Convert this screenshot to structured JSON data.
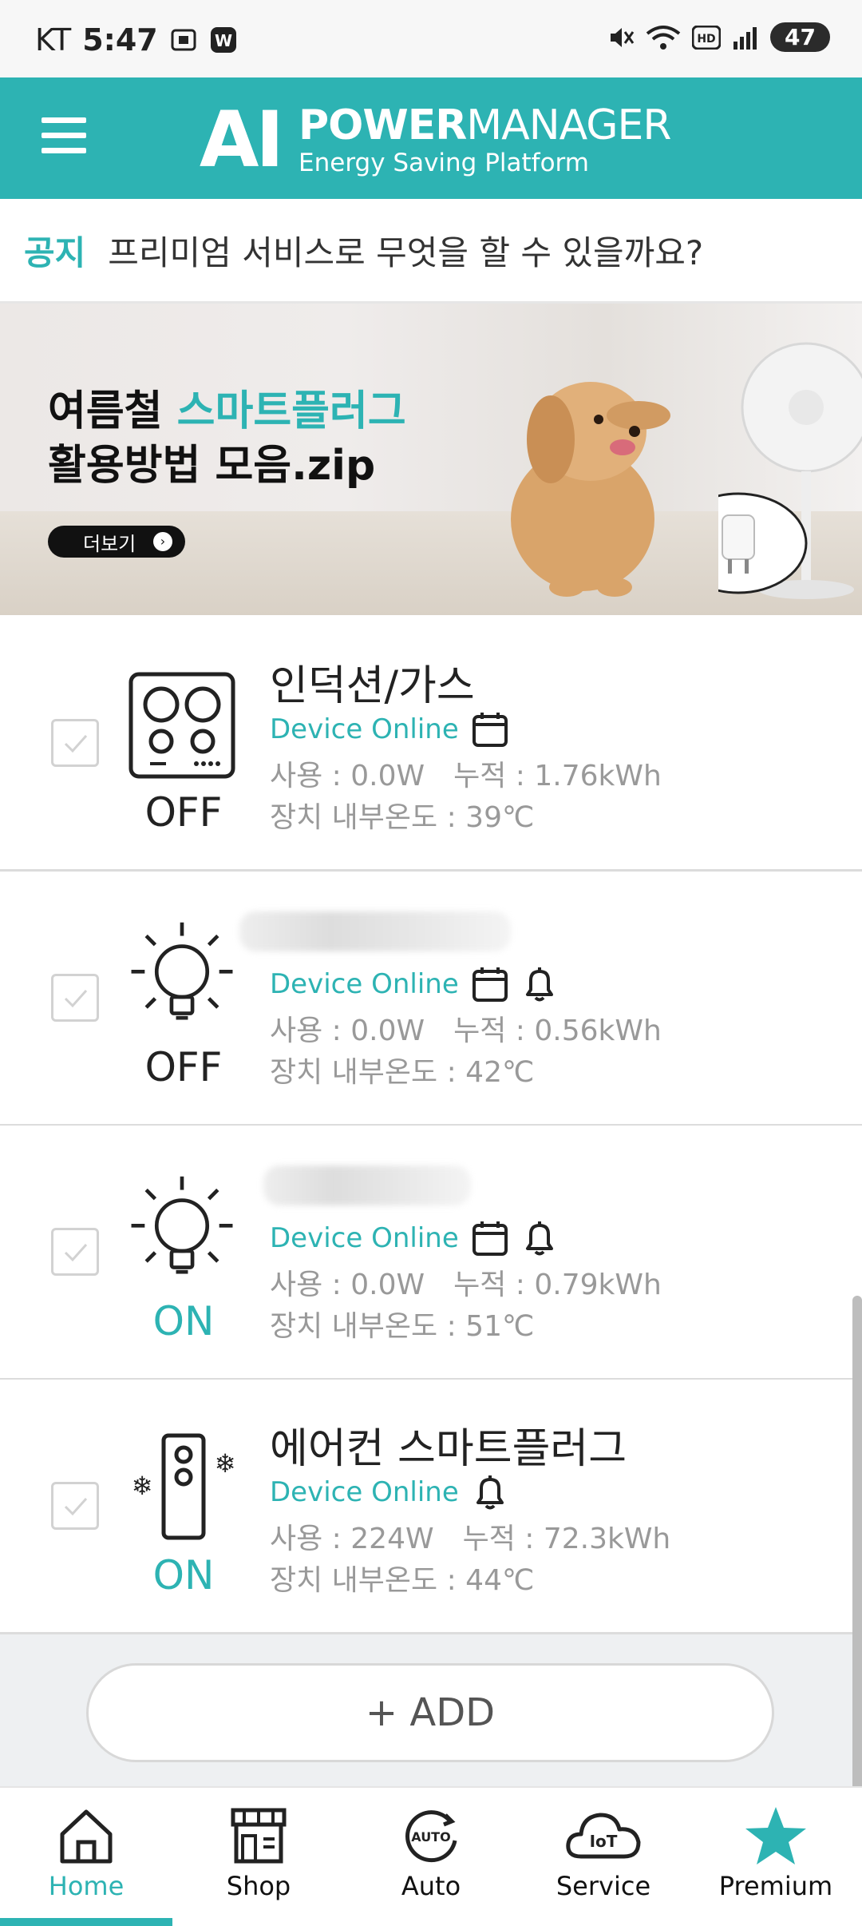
{
  "status_bar": {
    "carrier": "KT",
    "time": "5:47",
    "battery": "47"
  },
  "header": {
    "logo_ai": "AI",
    "logo_power": "POWER",
    "logo_manager": "MANAGER",
    "logo_subtitle": "Energy Saving Platform"
  },
  "notice": {
    "tag": "공지",
    "text": "프리미엄 서비스로 무엇을 할 수 있을까요?"
  },
  "banner": {
    "line1_prefix": "여름철",
    "line1_highlight": "스마트플러그",
    "line2": "활용방법 모음.zip",
    "more_label": "더보기"
  },
  "devices": [
    {
      "name": "인덕션/가스",
      "status": "Device Online",
      "usage": "사용 : 0.0W",
      "cumulative": "누적 : 1.76kWh",
      "temperature": "장치 내부온도 : 39℃",
      "state": "OFF",
      "icon": "induction-cooktop-icon",
      "has_calendar": true,
      "has_bell": false
    },
    {
      "name": "",
      "status": "Device Online",
      "usage": "사용 : 0.0W",
      "cumulative": "누적 : 0.56kWh",
      "temperature": "장치 내부온도 : 42℃",
      "state": "OFF",
      "icon": "light-bulb-icon",
      "has_calendar": true,
      "has_bell": true
    },
    {
      "name": "",
      "status": "Device Online",
      "usage": "사용 : 0.0W",
      "cumulative": "누적 : 0.79kWh",
      "temperature": "장치 내부온도 : 51℃",
      "state": "ON",
      "icon": "light-bulb-icon",
      "has_calendar": true,
      "has_bell": true
    },
    {
      "name": "에어컨 스마트플러그",
      "status": "Device Online",
      "usage": "사용 : 224W",
      "cumulative": "누적 : 72.3kWh",
      "temperature": "장치 내부온도 : 44℃",
      "state": "ON",
      "icon": "air-conditioner-remote-icon",
      "has_calendar": false,
      "has_bell": true
    }
  ],
  "add_button": "+ ADD",
  "bottom_nav": {
    "items": [
      {
        "label": "Home",
        "icon": "home-icon",
        "active": true
      },
      {
        "label": "Shop",
        "icon": "shop-icon",
        "active": false
      },
      {
        "label": "Auto",
        "icon": "auto-icon",
        "active": false
      },
      {
        "label": "Service",
        "icon": "iot-cloud-icon",
        "active": false
      },
      {
        "label": "Premium",
        "icon": "star-icon",
        "active": false
      }
    ]
  },
  "colors": {
    "accent": "#2db3b3",
    "text_dark": "#222222",
    "text_muted": "#999999"
  }
}
